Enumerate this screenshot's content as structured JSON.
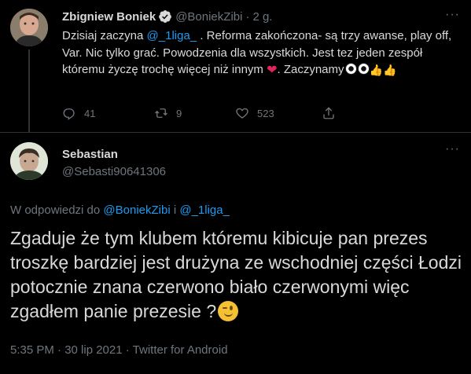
{
  "parent_tweet": {
    "author_name": "Zbigniew Boniek",
    "handle": "@BoniekZibi",
    "separator": "·",
    "time": "2 g.",
    "text_1": "Dzisiaj zaczyna ",
    "mention": "@_1liga_",
    "text_2": " . Reforma zakończona- są trzy awanse, play off, Var. Nic tylko grać. Powodzenia dla wszystkich. Jest tez jeden zespół któremu życzę trochę więcej niż innym ",
    "heart": "❤",
    "text_3": ". Zaczynamy",
    "thumbs": "👍👍",
    "reply_count": "41",
    "retweet_count": "9",
    "like_count": "523"
  },
  "main_tweet": {
    "author_name": "Sebastian",
    "handle": "@Sebasti90641306",
    "replying_prefix": "W odpowiedzi do ",
    "replying_mention_1": "@BoniekZibi",
    "replying_conj": " i ",
    "replying_mention_2": "@_1liga_",
    "text": "Zgaduje że tym klubem któremu kibicuje pan prezes troszkę bardziej jest drużyna ze wschodniej części Łodzi potocznie znana czerwono biało czerwonymi więc zgadłem panie prezesie ?",
    "meta": "5:35 PM · 30 lip 2021 · Twitter for Android"
  },
  "icons": {
    "more": "more-icon",
    "verified": "verified-badge-icon",
    "reply": "reply-icon",
    "retweet": "retweet-icon",
    "like": "like-icon",
    "share": "share-icon"
  },
  "colors": {
    "background": "#000000",
    "text": "#d9d9d9",
    "secondary": "#6e767d",
    "link": "#1d9bf0",
    "divider": "#2f3336"
  },
  "more_glyph": "···"
}
